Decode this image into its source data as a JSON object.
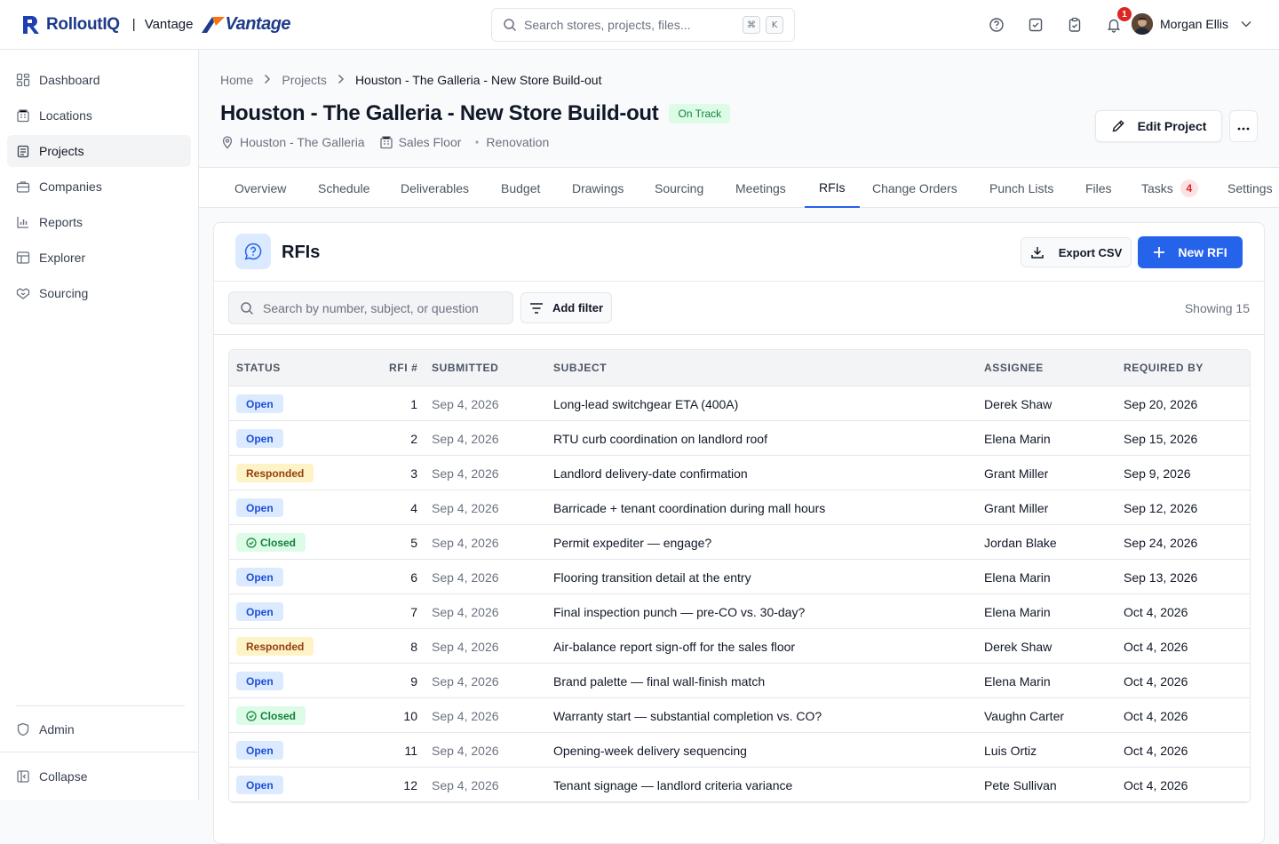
{
  "brand": {
    "name": "RolloutIQ",
    "separator": "|",
    "partner": "Vantage",
    "partner_logo": "Vantage"
  },
  "topbar": {
    "search_placeholder": "Search stores, projects, files...",
    "shortcut_keys": [
      "⌘",
      "K"
    ],
    "notification_count": "1",
    "user_name": "Morgan Ellis"
  },
  "sidebar": {
    "items": [
      {
        "label": "Dashboard",
        "icon": "dashboard-icon"
      },
      {
        "label": "Locations",
        "icon": "building-icon"
      },
      {
        "label": "Projects",
        "icon": "clipboard-icon",
        "active": true
      },
      {
        "label": "Companies",
        "icon": "briefcase-icon"
      },
      {
        "label": "Reports",
        "icon": "bar-chart-icon"
      },
      {
        "label": "Explorer",
        "icon": "table-icon"
      },
      {
        "label": "Sourcing",
        "icon": "handshake-icon"
      }
    ],
    "admin_label": "Admin",
    "collapse_label": "Collapse"
  },
  "breadcrumb": {
    "home": "Home",
    "projects": "Projects",
    "current": "Houston - The Galleria - New Store Build-out"
  },
  "project": {
    "title": "Houston - The Galleria - New Store Build-out",
    "status": "On Track",
    "location": "Houston - The Galleria",
    "area": "Sales Floor",
    "type": "Renovation",
    "edit_label": "Edit Project"
  },
  "tabs": [
    "Overview",
    "Schedule",
    "Deliverables",
    "Budget",
    "Drawings",
    "Sourcing",
    "Meetings",
    "RFIs",
    "Change Orders",
    "Punch Lists",
    "Files",
    "Tasks",
    "Settings"
  ],
  "tasks_count": "4",
  "rfi_panel": {
    "title": "RFIs",
    "export_label": "Export CSV",
    "new_label": "New RFI",
    "search_placeholder": "Search by number, subject, or question",
    "filter_label": "Add filter",
    "showing": "Showing 15",
    "columns": [
      "STATUS",
      "RFI #",
      "SUBMITTED",
      "SUBJECT",
      "ASSIGNEE",
      "REQUIRED BY"
    ],
    "rows": [
      {
        "status": "Open",
        "num": "1",
        "submitted": "Sep 4, 2026",
        "subject": "Long-lead switchgear ETA (400A)",
        "assignee": "Derek Shaw",
        "required": "Sep 20, 2026"
      },
      {
        "status": "Open",
        "num": "2",
        "submitted": "Sep 4, 2026",
        "subject": "RTU curb coordination on landlord roof",
        "assignee": "Elena Marin",
        "required": "Sep 15, 2026"
      },
      {
        "status": "Responded",
        "num": "3",
        "submitted": "Sep 4, 2026",
        "subject": "Landlord delivery-date confirmation",
        "assignee": "Grant Miller",
        "required": "Sep 9, 2026"
      },
      {
        "status": "Open",
        "num": "4",
        "submitted": "Sep 4, 2026",
        "subject": "Barricade + tenant coordination during mall hours",
        "assignee": "Grant Miller",
        "required": "Sep 12, 2026"
      },
      {
        "status": "Closed",
        "num": "5",
        "submitted": "Sep 4, 2026",
        "subject": "Permit expediter — engage?",
        "assignee": "Jordan Blake",
        "required": "Sep 24, 2026"
      },
      {
        "status": "Open",
        "num": "6",
        "submitted": "Sep 4, 2026",
        "subject": "Flooring transition detail at the entry",
        "assignee": "Elena Marin",
        "required": "Sep 13, 2026"
      },
      {
        "status": "Open",
        "num": "7",
        "submitted": "Sep 4, 2026",
        "subject": "Final inspection punch — pre-CO vs. 30-day?",
        "assignee": "Elena Marin",
        "required": "Oct 4, 2026"
      },
      {
        "status": "Responded",
        "num": "8",
        "submitted": "Sep 4, 2026",
        "subject": "Air-balance report sign-off for the sales floor",
        "assignee": "Derek Shaw",
        "required": "Oct 4, 2026"
      },
      {
        "status": "Open",
        "num": "9",
        "submitted": "Sep 4, 2026",
        "subject": "Brand palette — final wall-finish match",
        "assignee": "Elena Marin",
        "required": "Oct 4, 2026"
      },
      {
        "status": "Closed",
        "num": "10",
        "submitted": "Sep 4, 2026",
        "subject": "Warranty start — substantial completion vs. CO?",
        "assignee": "Vaughn Carter",
        "required": "Oct 4, 2026"
      },
      {
        "status": "Open",
        "num": "11",
        "submitted": "Sep 4, 2026",
        "subject": "Opening-week delivery sequencing",
        "assignee": "Luis Ortiz",
        "required": "Oct 4, 2026"
      },
      {
        "status": "Open",
        "num": "12",
        "submitted": "Sep 4, 2026",
        "subject": "Tenant signage — landlord criteria variance",
        "assignee": "Pete Sullivan",
        "required": "Oct 4, 2026"
      }
    ]
  },
  "colors": {
    "accent": "#2563eb",
    "brand": "#1e3a8a",
    "open_bg": "#dbeafe",
    "responded_bg": "#fef3c7",
    "closed_bg": "#dcfce7"
  }
}
